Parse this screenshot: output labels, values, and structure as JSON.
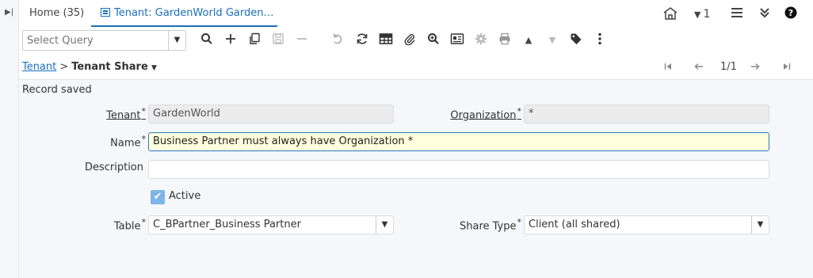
{
  "tabs": {
    "home_label": "Home (35)",
    "active_label": "Tenant: GardenWorld Garden…",
    "close_glyph": "✕"
  },
  "top_right": {
    "home_icon": "home-icon",
    "notification_count": "1",
    "menu_icon": "hamburger-icon",
    "collapse_icon": "double-chevron-down-icon",
    "help_icon": "help-icon"
  },
  "toolbar": {
    "query_placeholder": "Select Query",
    "buttons": [
      "search",
      "new",
      "copy",
      "save",
      "delete",
      "undo",
      "refresh",
      "grid",
      "attachment",
      "zoom",
      "report",
      "process",
      "print",
      "previous-record",
      "next-record",
      "tag",
      "more"
    ]
  },
  "breadcrumb": {
    "parent": "Tenant",
    "separator": ">",
    "current": "Tenant Share"
  },
  "navigation": {
    "record_position": "1/1"
  },
  "status": {
    "message": "Record saved"
  },
  "form": {
    "tenant_label": "Tenant",
    "tenant_value": "GardenWorld",
    "organization_label": "Organization",
    "organization_value": "*",
    "name_label": "Name",
    "name_value": "Business Partner must always have Organization *",
    "description_label": "Description",
    "description_value": "",
    "active_label": "Active",
    "active_checked": true,
    "table_label": "Table",
    "table_value": "C_BPartner_Business Partner",
    "share_type_label": "Share Type",
    "share_type_value": "Client (all shared)",
    "required_mark": "*"
  },
  "colors": {
    "accent": "#1a6ec0",
    "highlight_field": "#ffffdd",
    "readonly_field": "#ececec",
    "content_bg": "#f5f7fa"
  }
}
